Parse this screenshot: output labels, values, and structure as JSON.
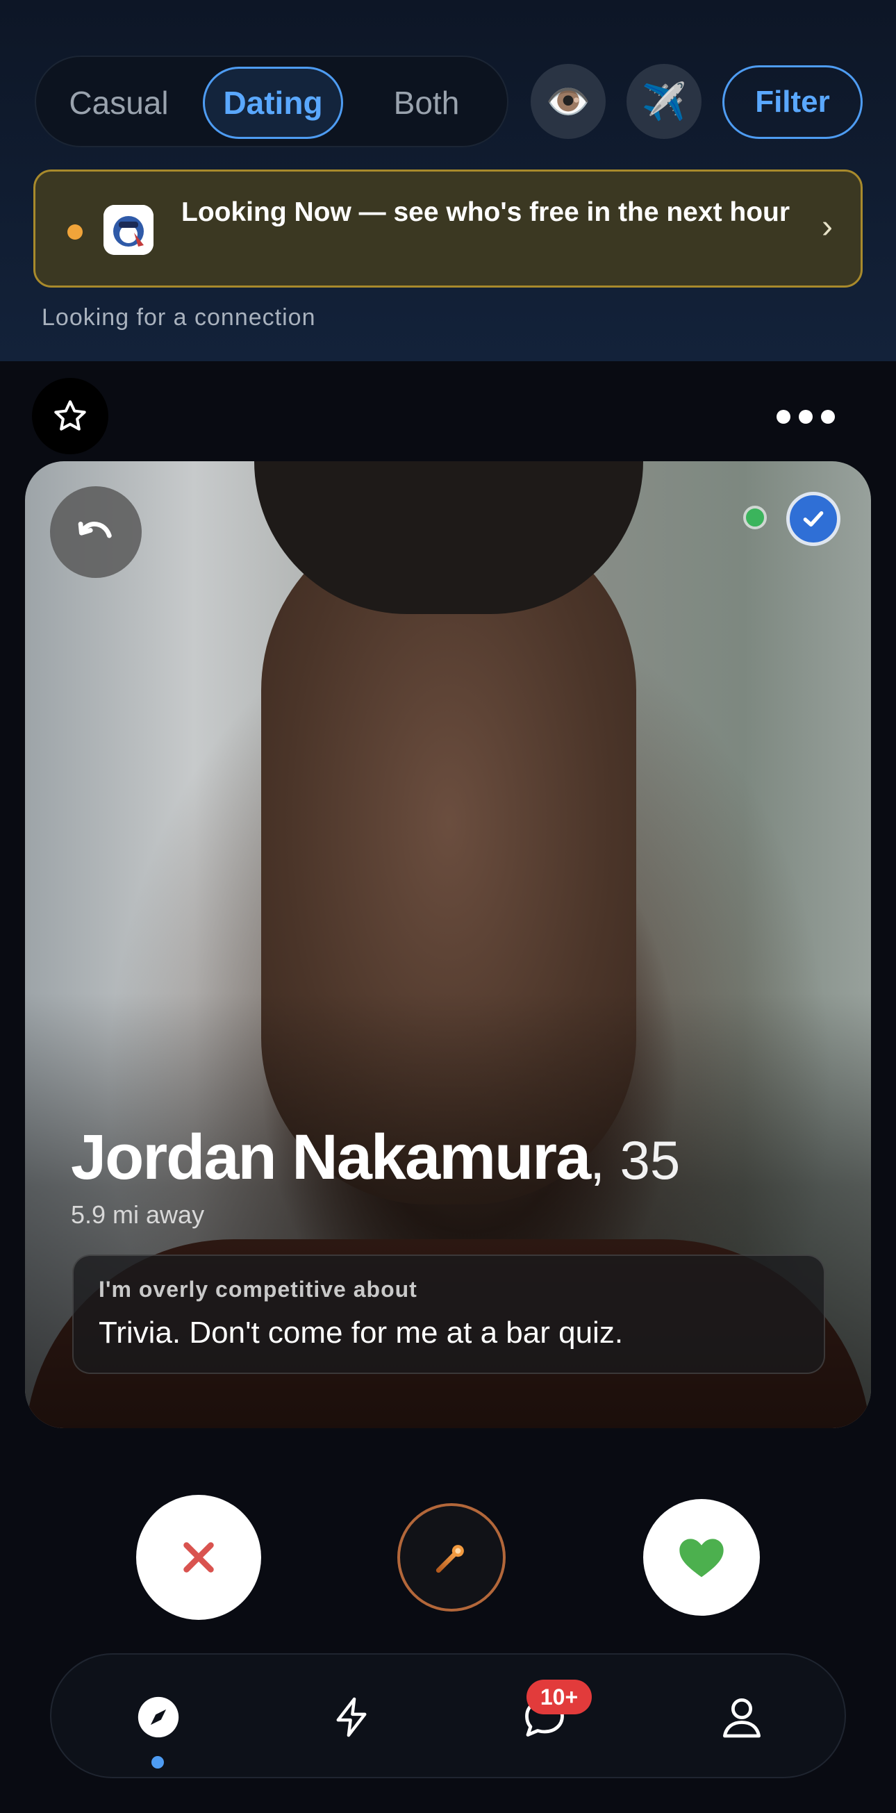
{
  "mode_selector": {
    "options": [
      "Casual",
      "Dating",
      "Both"
    ],
    "selected": "Dating"
  },
  "header_actions": {
    "eye_icon": "👁️",
    "plane_icon": "✈️",
    "filter_label": "Filter"
  },
  "banner": {
    "text": "Looking Now — see who's free in the next hour",
    "chevron": "›"
  },
  "subtitle": "Looking for a connection",
  "profile": {
    "name": "Jordan Nakamura",
    "age_text": ", 35",
    "distance": "5.9 mi away",
    "prompt_question": "I'm overly competitive about",
    "prompt_answer": "Trivia. Don't come for me at a bar quiz.",
    "online": true,
    "verified": true
  },
  "tabbar": {
    "tabs": [
      "discover",
      "activity",
      "chats",
      "profile"
    ],
    "active": "discover",
    "chat_badge": "10+"
  },
  "colors": {
    "accent_blue": "#4e9cf2",
    "banner_bg": "#3b3822",
    "nope_red": "#d9534f",
    "like_green": "#4cb04e",
    "badge_red": "#e23b3b"
  }
}
